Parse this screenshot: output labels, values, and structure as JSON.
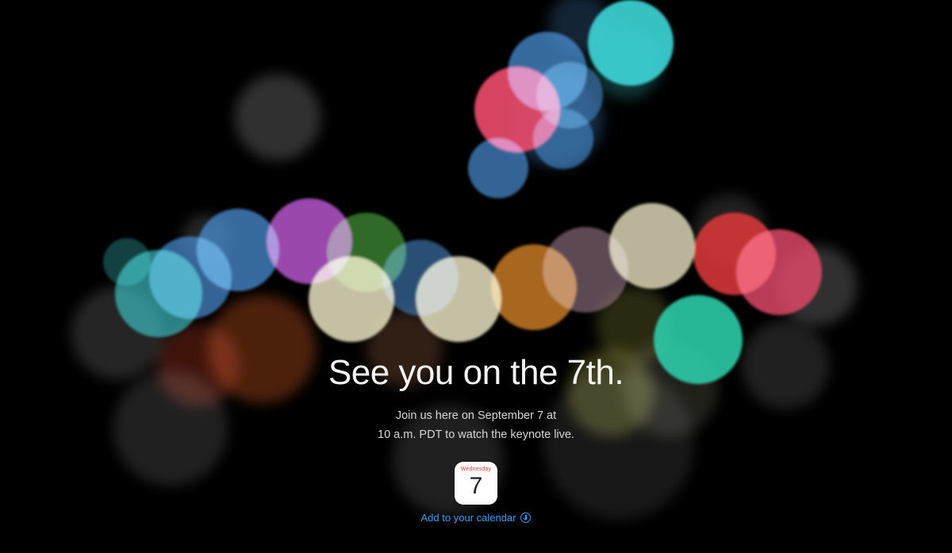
{
  "headline": "See you on the 7th.",
  "subline": {
    "line1": "Join us here on September 7 at",
    "line2": "10 a.m. PDT to watch the keynote live."
  },
  "calendar": {
    "day_name": "Wednesday",
    "day_number": "7",
    "add_label": "Add to your calendar",
    "icon": "download-arrow-icon"
  },
  "colors": {
    "background": "#000000",
    "link": "#3da0f0",
    "calendar_day": "#e3342f"
  },
  "bokeh_palette": [
    "#e84a6a",
    "#4a8fd4",
    "#3fd6d8",
    "#c05ad6",
    "#e8e2c0",
    "#e08a2a",
    "#e03a3a",
    "#4aa33a",
    "#2fd6b0",
    "#6a6a6a",
    "#8a3a1a"
  ]
}
